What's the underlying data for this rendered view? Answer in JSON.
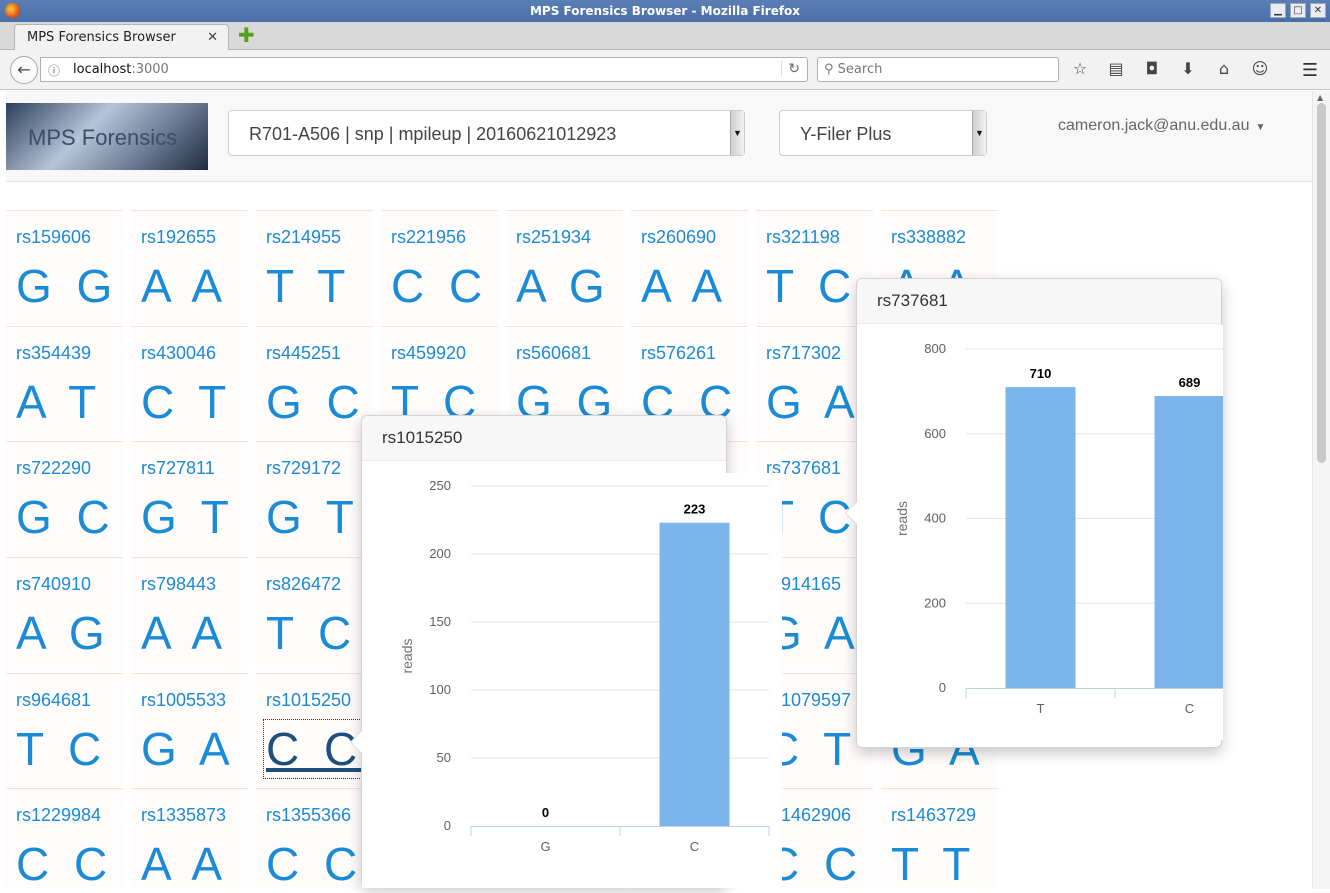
{
  "window": {
    "title": "MPS Forensics Browser - Mozilla Firefox",
    "tab_title": "MPS Forensics Browser",
    "url_host": "localhost",
    "url_port": ":3000",
    "search_placeholder": "Search"
  },
  "header": {
    "logo_text": "MPS Forensics",
    "sample_select": "R701-A506 | snp | mpileup | 20160621012923",
    "panel_select": "Y-Filer Plus",
    "user": "cameron.jack@anu.edu.au"
  },
  "grid": {
    "rows": [
      [
        {
          "rs": "rs159606",
          "gt": "G G"
        },
        {
          "rs": "rs192655",
          "gt": "A A"
        },
        {
          "rs": "rs214955",
          "gt": "T T"
        },
        {
          "rs": "rs221956",
          "gt": "C C"
        },
        {
          "rs": "rs251934",
          "gt": "A G"
        },
        {
          "rs": "rs260690",
          "gt": "A A"
        },
        {
          "rs": "rs321198",
          "gt": "T C"
        },
        {
          "rs": "rs338882",
          "gt": "A A"
        }
      ],
      [
        {
          "rs": "rs354439",
          "gt": "A T"
        },
        {
          "rs": "rs430046",
          "gt": "C T"
        },
        {
          "rs": "rs445251",
          "gt": "G C"
        },
        {
          "rs": "rs459920",
          "gt": "T C"
        },
        {
          "rs": "rs560681",
          "gt": "G G"
        },
        {
          "rs": "rs576261",
          "gt": "C C"
        },
        {
          "rs": "rs717302",
          "gt": "G A"
        },
        {
          "rs": "",
          "gt": ""
        }
      ],
      [
        {
          "rs": "rs722290",
          "gt": "G C"
        },
        {
          "rs": "rs727811",
          "gt": "G T"
        },
        {
          "rs": "rs729172",
          "gt": "G T"
        },
        {
          "rs": "",
          "gt": ""
        },
        {
          "rs": "",
          "gt": ""
        },
        {
          "rs": "",
          "gt": ""
        },
        {
          "rs": "rs737681",
          "gt": "T C"
        },
        {
          "rs": "",
          "gt": ""
        }
      ],
      [
        {
          "rs": "rs740910",
          "gt": "A G"
        },
        {
          "rs": "rs798443",
          "gt": "A A"
        },
        {
          "rs": "rs826472",
          "gt": "T C"
        },
        {
          "rs": "",
          "gt": ""
        },
        {
          "rs": "",
          "gt": ""
        },
        {
          "rs": "",
          "gt": ""
        },
        {
          "rs": "rs914165",
          "gt": "G A"
        },
        {
          "rs": "",
          "gt": ""
        }
      ],
      [
        {
          "rs": "rs964681",
          "gt": "T C"
        },
        {
          "rs": "rs1005533",
          "gt": "G A"
        },
        {
          "rs": "rs1015250",
          "gt": "C C"
        },
        {
          "rs": "",
          "gt": ""
        },
        {
          "rs": "",
          "gt": ""
        },
        {
          "rs": "",
          "gt": ""
        },
        {
          "rs": "rs1079597",
          "gt": "C T"
        },
        {
          "rs": "",
          "gt": "G A"
        }
      ],
      [
        {
          "rs": "rs1229984",
          "gt": "C C"
        },
        {
          "rs": "rs1335873",
          "gt": "A A"
        },
        {
          "rs": "rs1355366",
          "gt": "C C"
        },
        {
          "rs": "",
          "gt": ""
        },
        {
          "rs": "",
          "gt": ""
        },
        {
          "rs": "",
          "gt": ""
        },
        {
          "rs": "rs1462906",
          "gt": "C C"
        },
        {
          "rs": "rs1463729",
          "gt": "T T"
        }
      ]
    ]
  },
  "popovers": {
    "left_title": "rs1015250",
    "right_title": "rs737681"
  },
  "chart_data": [
    {
      "type": "bar",
      "title": "rs1015250",
      "categories": [
        "G",
        "C"
      ],
      "values": [
        0,
        223
      ],
      "ylabel": "reads",
      "ylim": [
        0,
        250
      ],
      "yticks": [
        0,
        50,
        100,
        150,
        200,
        250
      ],
      "grid": true,
      "bar_color": "#7cb5ec"
    },
    {
      "type": "bar",
      "title": "rs737681",
      "categories": [
        "T",
        "C"
      ],
      "values": [
        710,
        689
      ],
      "ylabel": "reads",
      "ylim": [
        0,
        800
      ],
      "yticks": [
        0,
        200,
        400,
        600,
        800
      ],
      "grid": true,
      "bar_color": "#7cb5ec"
    }
  ]
}
